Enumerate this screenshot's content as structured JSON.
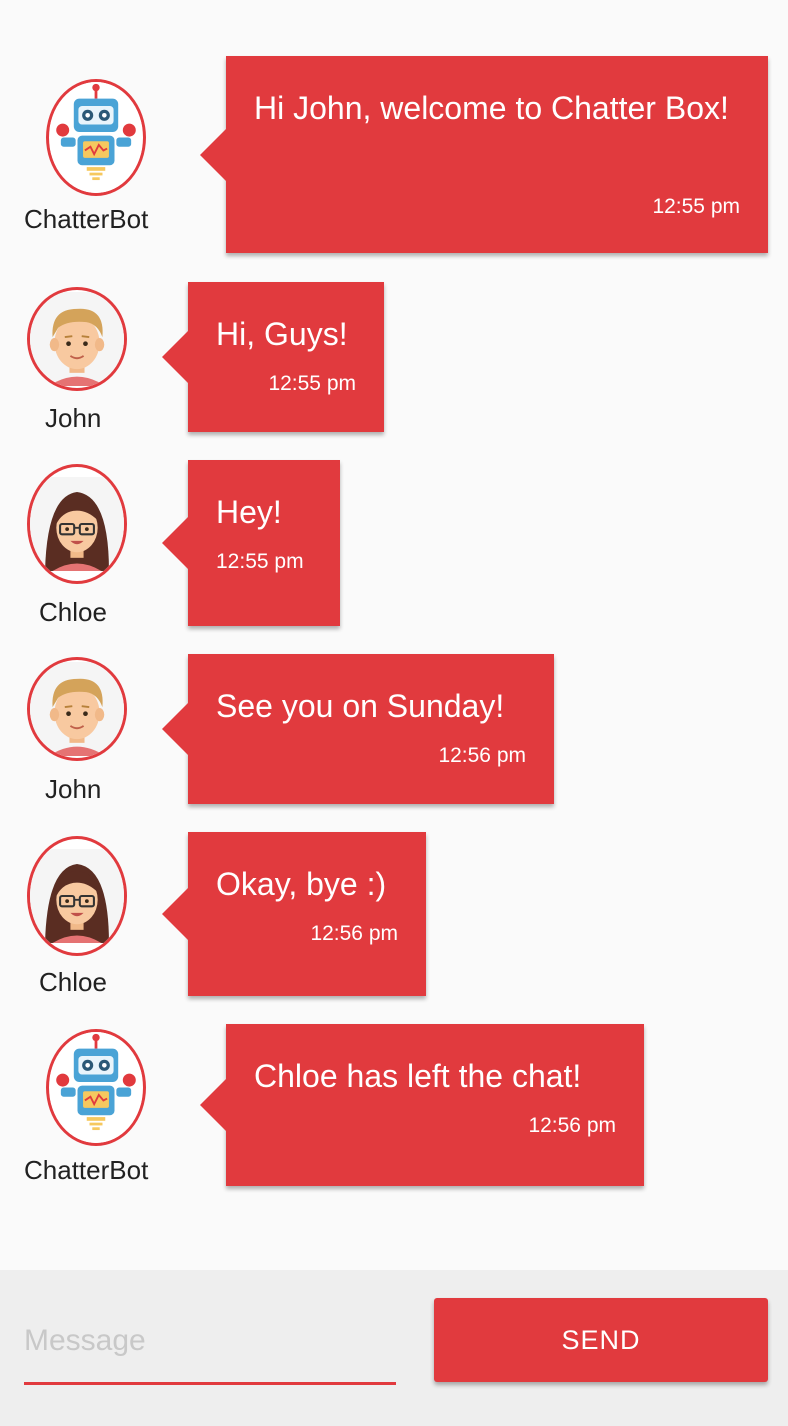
{
  "messages": [
    {
      "user": "ChatterBot",
      "avatar": "robot-avatar-icon",
      "text": "Hi John, welcome to Chatter Box!",
      "time": "12:55 pm"
    },
    {
      "user": "John",
      "avatar": "man-avatar-icon",
      "text": "Hi, Guys!",
      "time": "12:55 pm"
    },
    {
      "user": "Chloe",
      "avatar": "woman-avatar-icon",
      "text": "Hey!",
      "time": "12:55 pm"
    },
    {
      "user": "John",
      "avatar": "man-avatar-icon",
      "text": "See you on Sunday!",
      "time": "12:56 pm"
    },
    {
      "user": "Chloe",
      "avatar": "woman-avatar-icon",
      "text": "Okay, bye :)",
      "time": "12:56 pm"
    },
    {
      "user": "ChatterBot",
      "avatar": "robot-avatar-icon",
      "text": "Chloe has left the chat!",
      "time": "12:56 pm"
    }
  ],
  "composer": {
    "value": "",
    "placeholder": "Message",
    "send_label": "SEND"
  },
  "colors": {
    "accent": "#e13a3e",
    "background": "#fafafa",
    "composer_bg": "#eeeeee"
  }
}
